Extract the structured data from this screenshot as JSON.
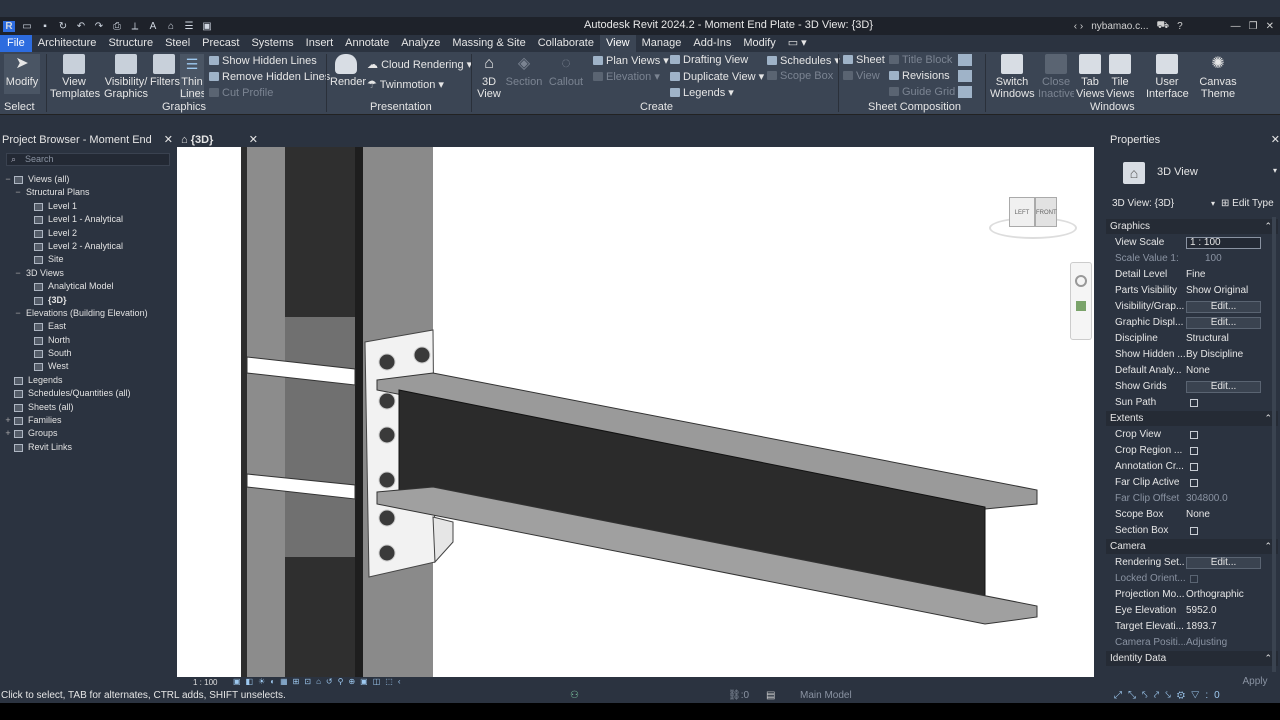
{
  "titlebar": {
    "app_title": "Autodesk Revit 2024.2 - Moment End Plate - 3D View: {3D}",
    "user": "nybamao.c...",
    "logo": "R",
    "help": "?",
    "icons": [
      "open-icon",
      "save-icon",
      "sync-icon",
      "undo-icon",
      "redo-icon",
      "print-icon",
      "measure-icon",
      "text-icon",
      "home-icon",
      "thin-lines-icon",
      "switch-windows-icon"
    ]
  },
  "menu": {
    "tabs": [
      "File",
      "Architecture",
      "Structure",
      "Steel",
      "Precast",
      "Systems",
      "Insert",
      "Annotate",
      "Analyze",
      "Massing & Site",
      "Collaborate",
      "View",
      "Manage",
      "Add-Ins",
      "Modify"
    ],
    "active": "View"
  },
  "ribbon": {
    "modify": "Modify",
    "select": "Select",
    "view_templates": "View Templates",
    "visibility_graphics": "Visibility/ Graphics",
    "filters": "Filters",
    "thin_lines": "Thin Lines",
    "show_hidden_lines": "Show  Hidden Lines",
    "remove_hidden_lines": "Remove  Hidden Lines",
    "cut_profile": "Cut  Profile",
    "graphics_panel": "Graphics",
    "render": "Render",
    "cloud_rendering": "Cloud  Rendering",
    "twinmotion": "Twinmotion",
    "presentation_panel": "Presentation",
    "view_3d": "3D View",
    "section": "Section",
    "callout": "Callout",
    "plan_views": "Plan  Views",
    "elevation": "Elevation",
    "drafting_view": "Drafting  View",
    "duplicate_view": "Duplicate  View",
    "legends": "Legends",
    "schedules": "Schedules",
    "scope_box": "Scope  Box",
    "create_panel": "Create",
    "sheet": "Sheet",
    "view": "View",
    "title_block": "Title  Block",
    "revisions": "Revisions",
    "guide_grid": "Guide  Grid",
    "sheet_panel": "Sheet Composition",
    "switch_windows": "Switch Windows",
    "close_inactive": "Close Inactive",
    "tab_views": "Tab Views",
    "tile_views": "Tile Views",
    "user_interface": "User Interface",
    "canvas_theme": "Canvas Theme",
    "windows_panel": "Windows"
  },
  "project_browser": {
    "title": "Project Browser - Moment End Plate",
    "search_placeholder": "Search",
    "items": [
      {
        "label": "Views (all)",
        "level": 0,
        "exp": "−"
      },
      {
        "label": "Structural Plans",
        "level": 1,
        "exp": "−"
      },
      {
        "label": "Level 1",
        "level": 2,
        "exp": ""
      },
      {
        "label": "Level 1 - Analytical",
        "level": 2,
        "exp": ""
      },
      {
        "label": "Level 2",
        "level": 2,
        "exp": ""
      },
      {
        "label": "Level 2 - Analytical",
        "level": 2,
        "exp": ""
      },
      {
        "label": "Site",
        "level": 2,
        "exp": ""
      },
      {
        "label": "3D Views",
        "level": 1,
        "exp": "−"
      },
      {
        "label": "Analytical Model",
        "level": 2,
        "exp": ""
      },
      {
        "label": "{3D}",
        "level": 2,
        "exp": "",
        "bold": true
      },
      {
        "label": "Elevations (Building Elevation)",
        "level": 1,
        "exp": "−"
      },
      {
        "label": "East",
        "level": 2,
        "exp": ""
      },
      {
        "label": "North",
        "level": 2,
        "exp": ""
      },
      {
        "label": "South",
        "level": 2,
        "exp": ""
      },
      {
        "label": "West",
        "level": 2,
        "exp": ""
      },
      {
        "label": "Legends",
        "level": 0,
        "exp": ""
      },
      {
        "label": "Schedules/Quantities (all)",
        "level": 0,
        "exp": ""
      },
      {
        "label": "Sheets (all)",
        "level": 0,
        "exp": ""
      },
      {
        "label": "Families",
        "level": 0,
        "exp": "+"
      },
      {
        "label": "Groups",
        "level": 0,
        "exp": "+"
      },
      {
        "label": "Revit Links",
        "level": 0,
        "exp": ""
      }
    ]
  },
  "view_tab": {
    "label": "{3D}"
  },
  "viewcube": {
    "left": "LEFT",
    "front": "FRONT"
  },
  "view_bar": {
    "scale": "1 : 100"
  },
  "properties": {
    "title": "Properties",
    "type_name": "3D View",
    "selector": "3D View: {3D}",
    "edit_type": "Edit Type",
    "apply": "Apply",
    "sections": [
      {
        "name": "Graphics",
        "rows": [
          {
            "k": "View Scale",
            "v": "1 : 100",
            "kind": "input"
          },
          {
            "k": "Scale Value   1:",
            "v": "100",
            "kind": "dim"
          },
          {
            "k": "Detail Level",
            "v": "Fine",
            "kind": "text"
          },
          {
            "k": "Parts Visibility",
            "v": "Show Original",
            "kind": "text"
          },
          {
            "k": "Visibility/Grap...",
            "v": "Edit...",
            "kind": "btn"
          },
          {
            "k": "Graphic Displ...",
            "v": "Edit...",
            "kind": "btn"
          },
          {
            "k": "Discipline",
            "v": "Structural",
            "kind": "text"
          },
          {
            "k": "Show Hidden ...",
            "v": "By Discipline",
            "kind": "text"
          },
          {
            "k": "Default Analy...",
            "v": "None",
            "kind": "text"
          },
          {
            "k": "Show Grids",
            "v": "Edit...",
            "kind": "btn"
          },
          {
            "k": "Sun Path",
            "v": "",
            "kind": "chk"
          }
        ]
      },
      {
        "name": "Extents",
        "rows": [
          {
            "k": "Crop View",
            "v": "",
            "kind": "chk"
          },
          {
            "k": "Crop Region ...",
            "v": "",
            "kind": "chk"
          },
          {
            "k": "Annotation Cr...",
            "v": "",
            "kind": "chk"
          },
          {
            "k": "Far Clip Active",
            "v": "",
            "kind": "chk"
          },
          {
            "k": "Far Clip Offset",
            "v": "304800.0",
            "kind": "dimboth"
          },
          {
            "k": "Scope Box",
            "v": "None",
            "kind": "text"
          },
          {
            "k": "Section Box",
            "v": "",
            "kind": "chk"
          }
        ]
      },
      {
        "name": "Camera",
        "rows": [
          {
            "k": "Rendering Set...",
            "v": "Edit...",
            "kind": "btn"
          },
          {
            "k": "Locked Orient...",
            "v": "",
            "kind": "chkdim"
          },
          {
            "k": "Projection Mo...",
            "v": "Orthographic",
            "kind": "text"
          },
          {
            "k": "Eye Elevation",
            "v": "5952.0",
            "kind": "text"
          },
          {
            "k": "Target Elevati...",
            "v": "1893.7",
            "kind": "text"
          },
          {
            "k": "Camera Positi...",
            "v": "Adjusting",
            "kind": "dimboth"
          }
        ]
      },
      {
        "name": "Identity Data",
        "rows": []
      }
    ]
  },
  "status": {
    "text": "Click to select, TAB for alternates, CTRL adds, SHIFT unselects.",
    "worksets_count": ":0",
    "model": "Main Model"
  }
}
